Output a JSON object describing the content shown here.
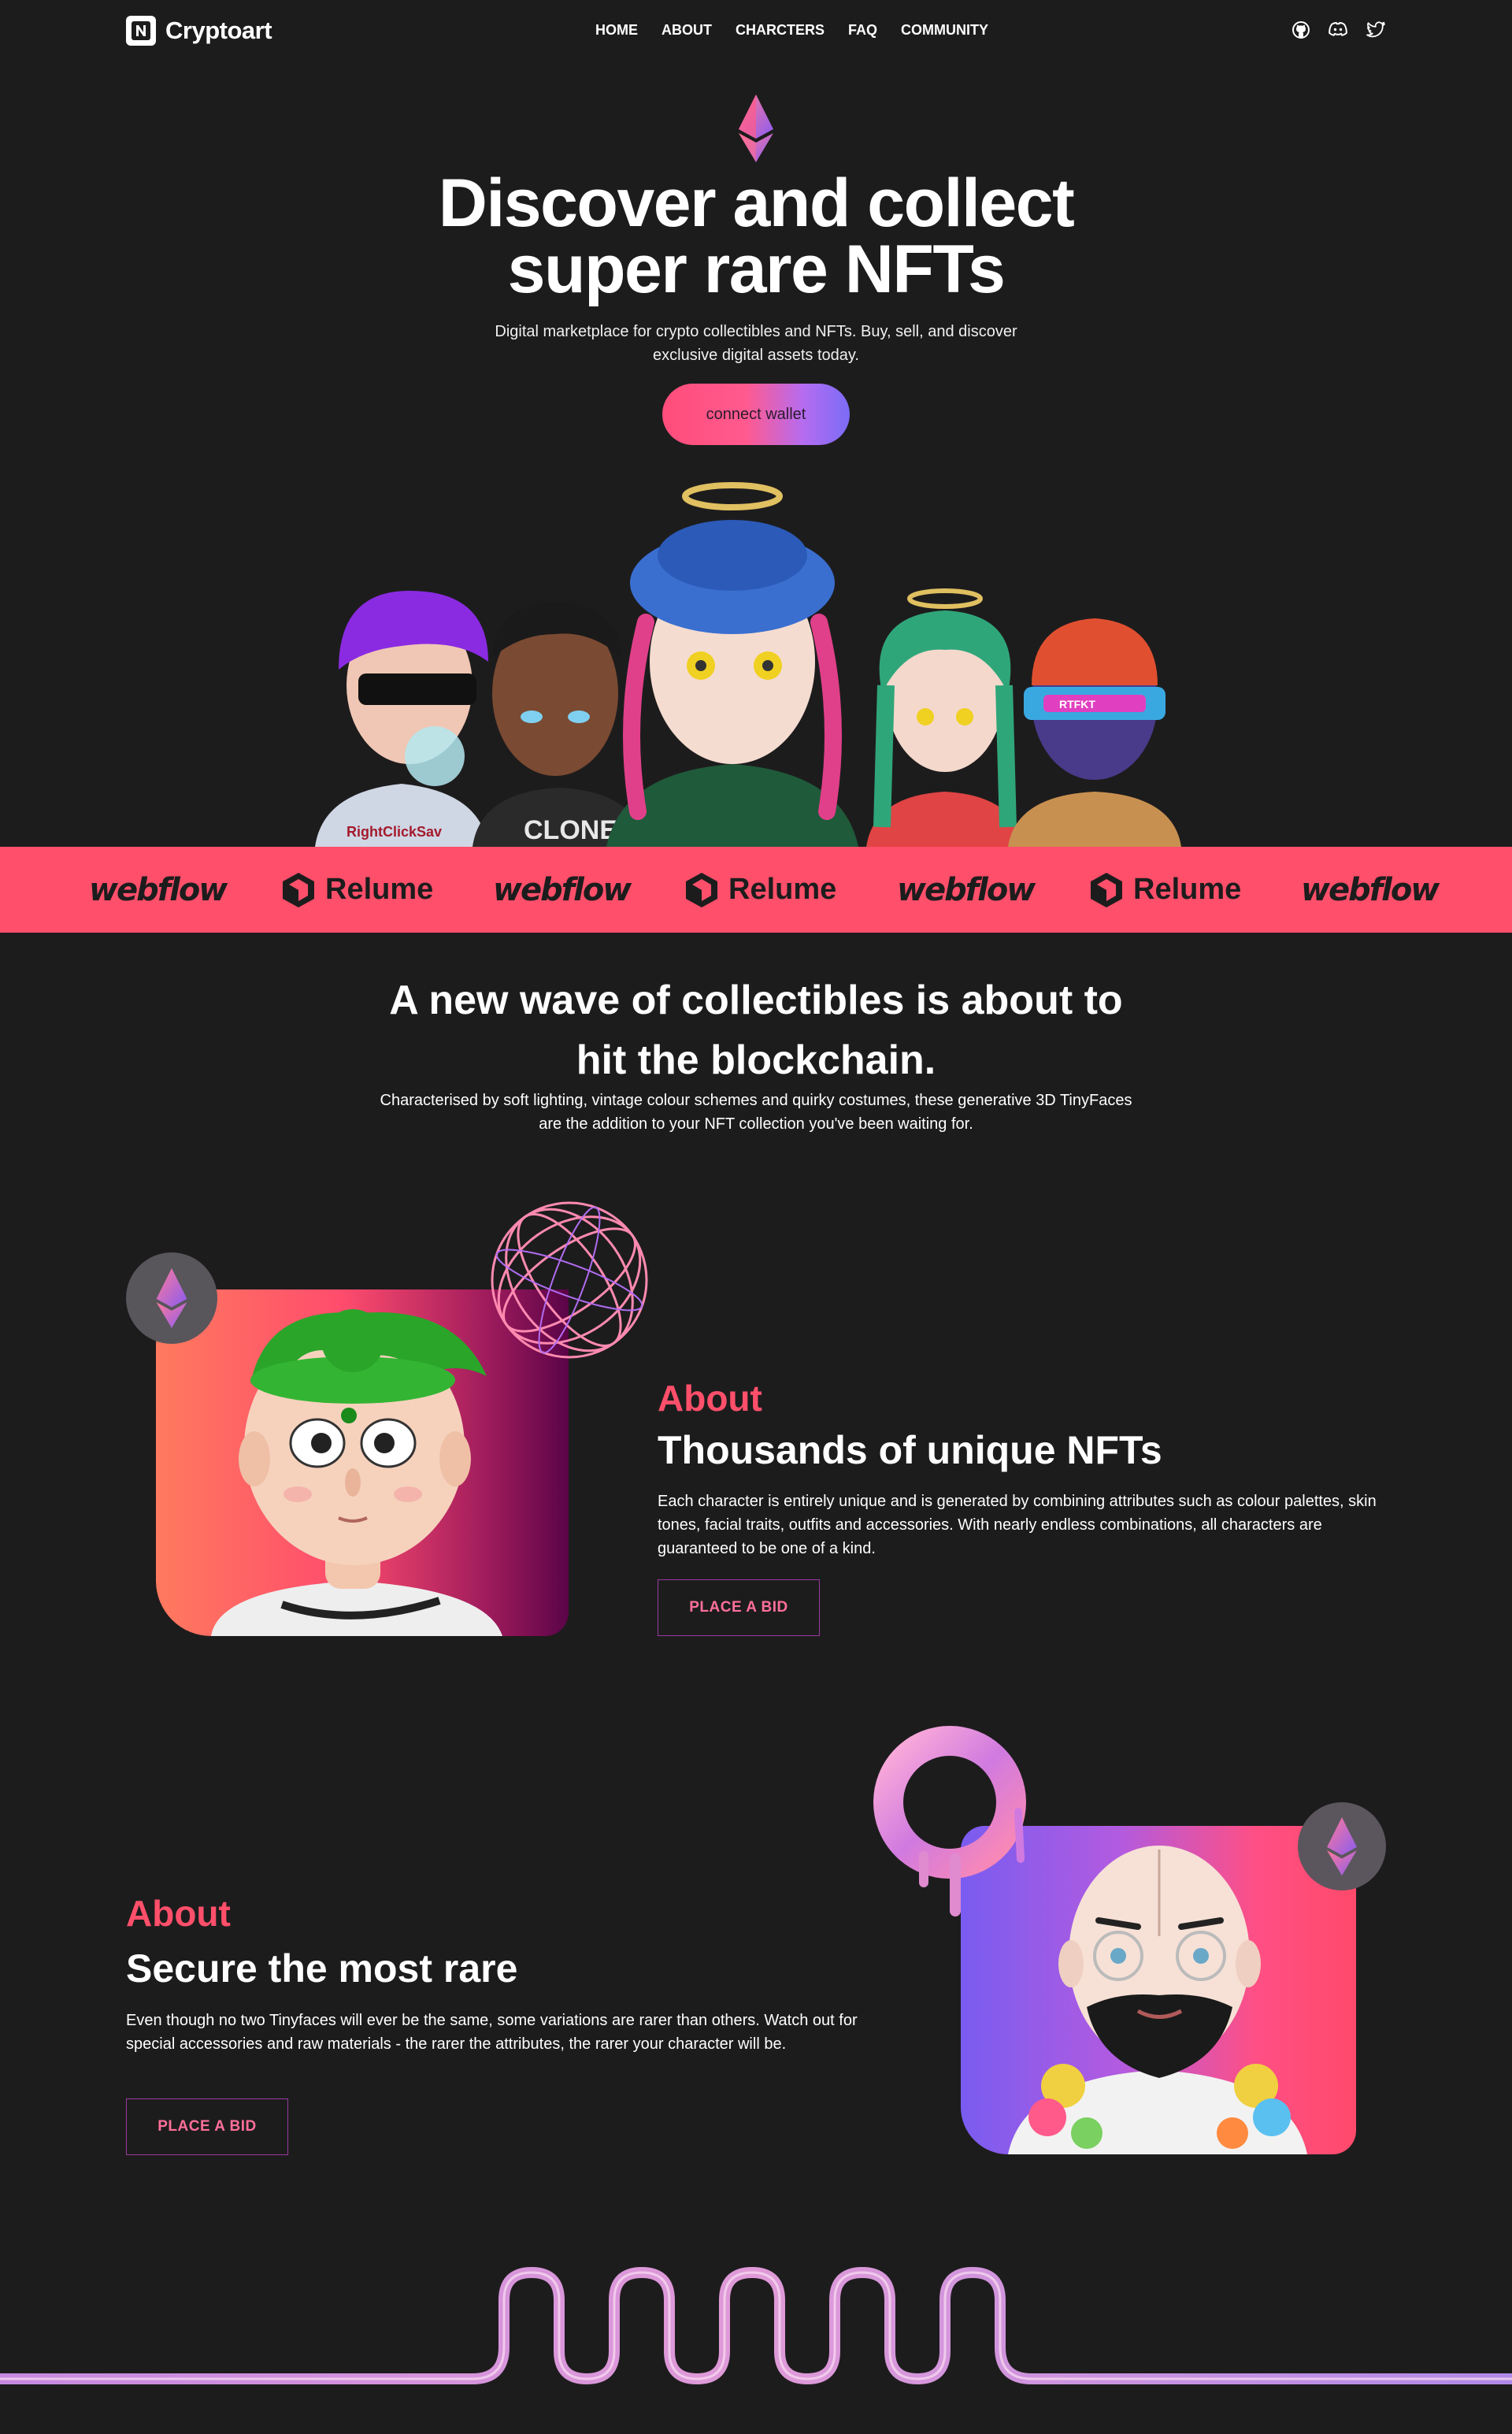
{
  "nav": {
    "brand": "Cryptoart",
    "links": [
      "HOME",
      "ABOUT",
      "CHARCTERS",
      "FAQ",
      "COMMUNITY"
    ],
    "icons": [
      "github-icon",
      "discord-icon",
      "twitter-icon"
    ]
  },
  "hero": {
    "title_line1": "Discover and collect",
    "title_line2": "super rare NFTs",
    "subtitle": "Digital marketplace for crypto collectibles and NFTs. Buy, sell, and discover exclusive digital assets today.",
    "cta_label": "connect wallet"
  },
  "band": {
    "brands": [
      "webflow",
      "Relume",
      "webflow",
      "Relume",
      "webflow",
      "Relume",
      "webflow"
    ],
    "color": "#ff4f6a"
  },
  "wave": {
    "title_line1": "A new wave of collectibles is about to",
    "title_line2": "hit the blockchain.",
    "subtitle": "Characterised by soft lighting, vintage colour schemes and quirky costumes, these generative 3D TinyFaces are the addition to your NFT collection you've been waiting for."
  },
  "feature1": {
    "kicker": "About",
    "title": "Thousands of unique NFTs",
    "body": "Each character is entirely unique and is generated by combining attributes such as colour palettes, skin tones, facial traits, outfits and accessories. With nearly endless combinations, all characters are guaranteed to be one of a kind.",
    "button_label": "PLACE A BID"
  },
  "feature2": {
    "kicker": "About",
    "title": "Secure the most rare",
    "body": "Even though no two Tinyfaces will ever be the same, some variations are rarer than others. Watch out for special accessories and raw materials - the rarer the attributes, the rarer your character will be.",
    "button_label": "PLACE A BID"
  },
  "colors": {
    "background": "#1d1c1d",
    "accent": "#ff4f6a",
    "gradient_start": "#ff4d7a",
    "gradient_end": "#7b6cf6"
  }
}
